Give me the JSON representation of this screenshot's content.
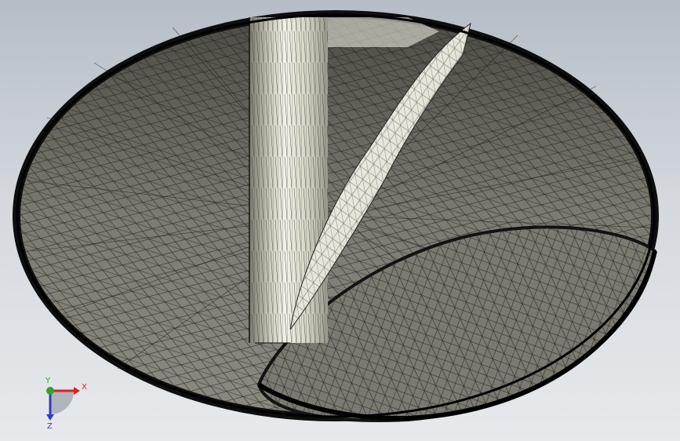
{
  "viewport": {
    "background_top": "#b6bdc6",
    "background_bottom": "#e7e9ec"
  },
  "model": {
    "shell_fill": "#6f6f66",
    "shell_edge": "#111111",
    "highlight_fill": "#f2f1e6",
    "cylinder_fill": "#dcdacb",
    "mesh_line": "#1c1c1c"
  },
  "triad": {
    "x_label": "X",
    "y_label": "Y",
    "z_label": "Z",
    "x_color": "#e02020",
    "y_color": "#2ea62e",
    "z_color": "#2e3fbf"
  }
}
